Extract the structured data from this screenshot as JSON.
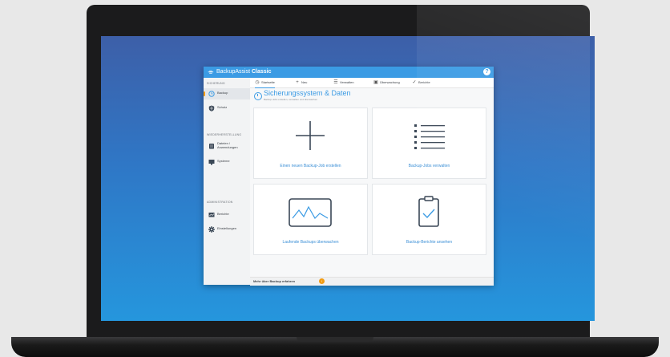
{
  "app": {
    "name": "BackupAssist",
    "edition": "Classic",
    "help": "?"
  },
  "sidebar": {
    "sections": [
      {
        "title": "SICHERUNG"
      },
      {
        "title": "WIEDERHERSTELLUNG"
      },
      {
        "title": "ADMINISTRATION"
      }
    ],
    "items": [
      {
        "label": "Backup",
        "icon": "clock-icon"
      },
      {
        "label": "Schutz",
        "icon": "shield-icon"
      },
      {
        "label": "Dateien / Anwendungen",
        "icon": "database-icon"
      },
      {
        "label": "Systeme",
        "icon": "monitor-icon"
      },
      {
        "label": "Berichte",
        "icon": "report-icon"
      },
      {
        "label": "Einstellungen",
        "icon": "gear-icon"
      }
    ]
  },
  "tabs": [
    {
      "label": "Startseite",
      "icon": "home-icon"
    },
    {
      "label": "Neu",
      "icon": "plus-icon"
    },
    {
      "label": "Verwalten",
      "icon": "list-icon"
    },
    {
      "label": "Überwachung",
      "icon": "chart-icon"
    },
    {
      "label": "Berichte",
      "icon": "check-icon"
    }
  ],
  "page": {
    "title": "Sicherungssystem & Daten",
    "subtitle": "Backup-Jobs erstellen, verwalten und überwachen"
  },
  "cards": [
    {
      "label": "Einen neuen Backup-Job erstellen",
      "icon": "plus-icon"
    },
    {
      "label": "Backup-Jobs verwalten",
      "icon": "list-icon"
    },
    {
      "label": "Laufende Backups überwachen",
      "icon": "monitor-graph-icon"
    },
    {
      "label": "Backup-Berichte ansehen",
      "icon": "clipboard-check-icon"
    }
  ],
  "footer": {
    "text": "Mehr über Backup erfahren",
    "badge": "!"
  },
  "colors": {
    "accent": "#3b9be4",
    "warning": "#f39c12",
    "icon": "#3a4756"
  }
}
